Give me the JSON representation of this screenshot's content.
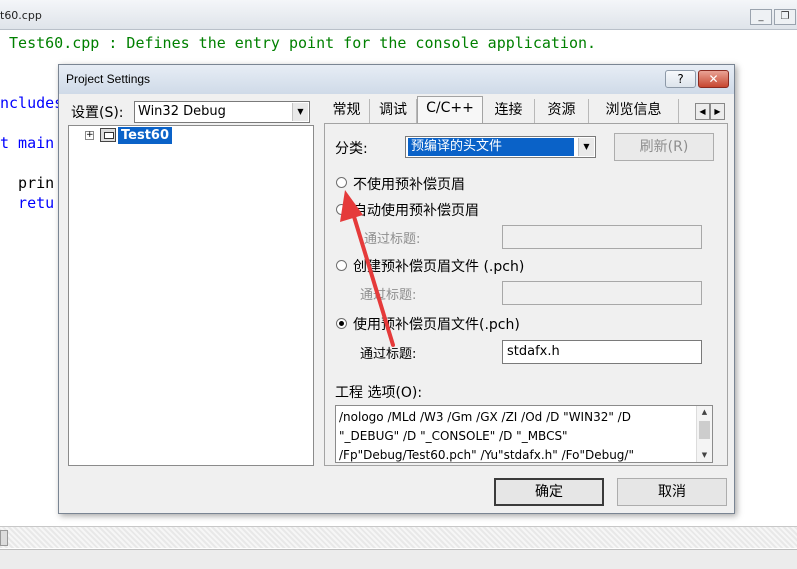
{
  "editor": {
    "tab_title": "t60.cpp",
    "code_lines": [
      " Test60.cpp : Defines the entry point for the console application.",
      "ncludes",
      "t main",
      "  prin",
      "  retu"
    ]
  },
  "dialog": {
    "title": "Project Settings",
    "help_label": "?",
    "close_label": "✕",
    "settings_label": "设置(S):",
    "settings_value": "Win32 Debug",
    "tree_item": "Test60",
    "tabs": [
      "常规",
      "调试",
      "C/C++",
      "连接",
      "资源",
      "浏览信息"
    ],
    "active_tab": "C/C++",
    "category_label": "分类:",
    "category_value": "预编译的头文件",
    "refresh_label": "刷新(R)",
    "options": {
      "no_pch": "不使用预补偿页眉",
      "auto_pch": "自动使用预补偿页眉",
      "auto_through_label": "通过标题:",
      "create_pch": "创建预补偿页眉文件 (.pch)",
      "create_through_label": "通过标题:",
      "use_pch": "使用预补偿页眉文件(.pch)",
      "use_through_label": "通过标题:",
      "use_through_value": "stdafx.h",
      "selected": "use_pch"
    },
    "project_options_label": "工程 选项(O):",
    "project_options_text": "/nologo /MLd /W3 /Gm /GX /ZI /Od /D \"WIN32\" /D\n\"_DEBUG\" /D \"_CONSOLE\" /D \"_MBCS\"\n/Fp\"Debug/Test60.pch\" /Yu\"stdafx.h\" /Fo\"Debug/\"",
    "ok_label": "确定",
    "cancel_label": "取消"
  },
  "colors": {
    "annotation_arrow": "#e53a3a",
    "selection": "#0a62c8",
    "comment": "#008000",
    "keyword": "#0000ff"
  }
}
